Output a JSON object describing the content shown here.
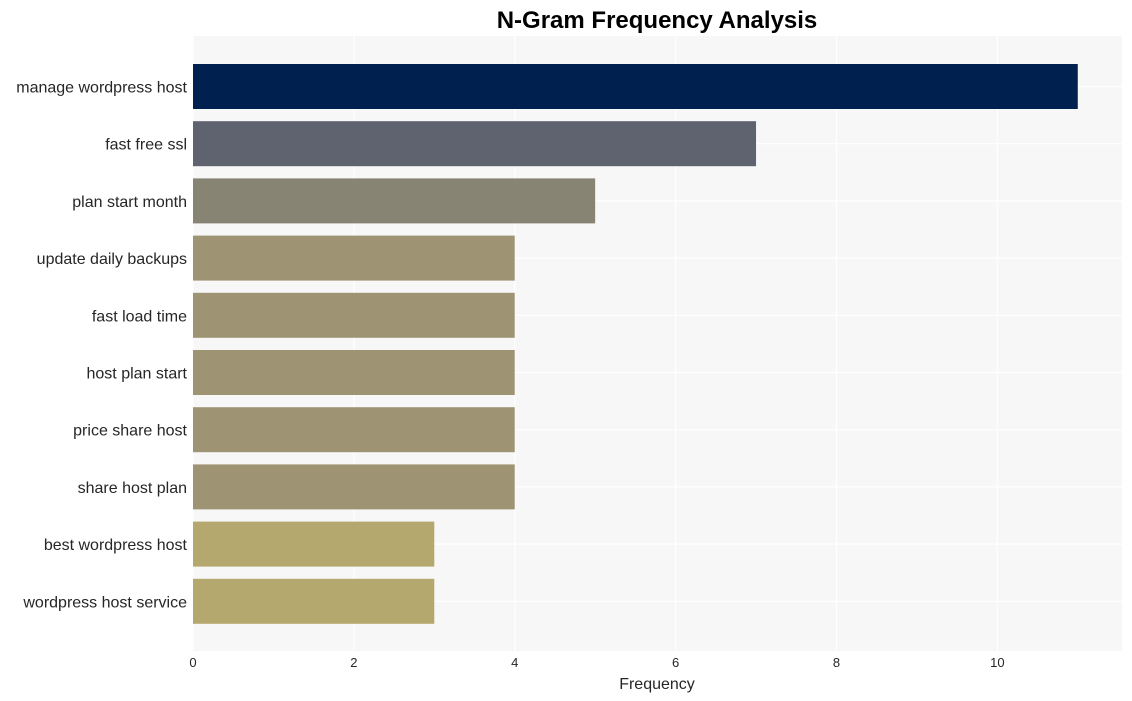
{
  "chart_data": {
    "type": "bar",
    "orientation": "horizontal",
    "title": "N-Gram Frequency Analysis",
    "xlabel": "Frequency",
    "ylabel": "",
    "xlim": [
      0,
      11.55
    ],
    "xticks": [
      0,
      2,
      4,
      6,
      8,
      10
    ],
    "grid": true,
    "categories": [
      "manage wordpress host",
      "fast free ssl",
      "plan start month",
      "update daily backups",
      "fast load time",
      "host plan start",
      "price share host",
      "share host plan",
      "best wordpress host",
      "wordpress host service"
    ],
    "values": [
      11,
      7,
      5,
      4,
      4,
      4,
      4,
      4,
      3,
      3
    ],
    "colors": [
      "#00204f",
      "#5f6370",
      "#878474",
      "#9e9474",
      "#9e9474",
      "#9e9474",
      "#9e9474",
      "#9e9474",
      "#b5a86e",
      "#b5a86e"
    ],
    "background_color": "#f7f7f8",
    "grid_color": "#ffffff"
  }
}
